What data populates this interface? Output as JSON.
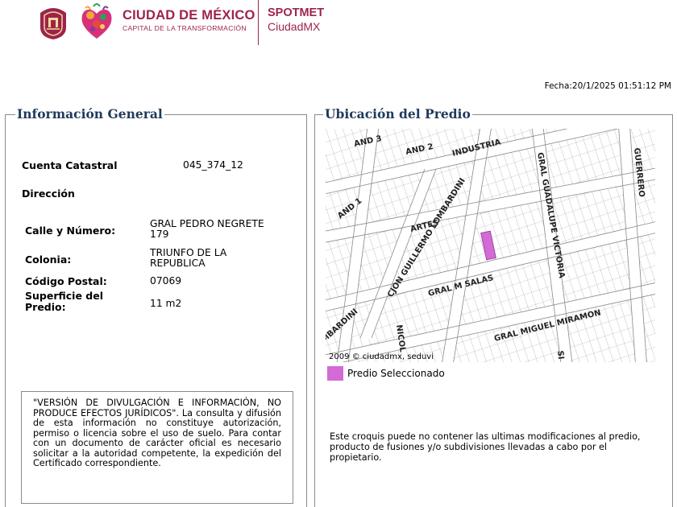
{
  "header": {
    "brand_title": "CIUDAD DE MÉXICO",
    "brand_subtitle": "CAPITAL DE LA TRANSFORMACIÓN",
    "app_name_1": "SPOTMET",
    "app_name_2": "CiudadMX",
    "brand_color": "#9d2449"
  },
  "timestamp": "Fecha:20/1/2025 01:51:12 PM",
  "general": {
    "legend": "Información General",
    "cuenta_label": "Cuenta Catastral",
    "cuenta_value": "045_374_12",
    "direccion_label": "Dirección",
    "calle_label": "Calle y Número:",
    "calle_value_1": "GRAL PEDRO NEGRETE",
    "calle_value_2": "179",
    "colonia_label": "Colonia:",
    "colonia_value_1": "TRIUNFO DE LA",
    "colonia_value_2": "REPUBLICA",
    "cp_label": "Código Postal:",
    "cp_value": "07069",
    "superficie_label_1": "Superficie del",
    "superficie_label_2": "Predio:",
    "superficie_value": "11 m2",
    "notice": "\"VERSIÓN DE DIVULGACIÓN E INFORMACIÓN, NO PRODUCE EFECTOS JURÍDICOS\". La consulta y difusión de esta información no constituye autorización, permiso o licencia sobre el uso de suelo. Para contar con un documento de carácter oficial es necesario solicitar a la autoridad competente, la expedición del Certificado correspondiente."
  },
  "ubicacion": {
    "legend": "Ubicación del Predio",
    "streets": {
      "and3": "AND 3",
      "and2": "AND 2",
      "industria": "INDUSTRIA",
      "guerrero": "GUERRERO",
      "gral_guadalupe_victoria": "GRAL GUADALUPE VICTORIA",
      "and1": "AND 1",
      "artes": "ARTES",
      "guillermo_lombardini": "CJON GUILLERMO LOMBARDINI",
      "gral_m_salas": "GRAL M SALAS",
      "lombardini": "MBARDINI",
      "nicol": "NICOL",
      "gral_miguel_miramon": "GRAL MIGUEL MIRAMON",
      "si": "SI"
    },
    "copyright": "2009 © ciudadmx, seduvi",
    "legend_label": "Predio Seleccionado",
    "legend_color": "#d36ad6",
    "disclaimer": "Este croquis puede no contener las ultimas modificaciones al predio, producto de fusiones y/o subdivisiones llevadas a cabo por el propietario."
  }
}
